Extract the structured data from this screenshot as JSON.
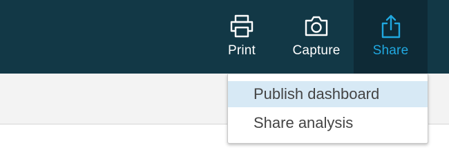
{
  "toolbar": {
    "print": {
      "label": "Print",
      "icon": "printer-icon"
    },
    "capture": {
      "label": "Capture",
      "icon": "camera-icon"
    },
    "share": {
      "label": "Share",
      "icon": "share-icon",
      "active": true
    }
  },
  "share_menu": {
    "items": [
      {
        "label": "Publish dashboard",
        "highlighted": true
      },
      {
        "label": "Share analysis",
        "highlighted": false
      }
    ]
  },
  "colors": {
    "topbar": "#123846",
    "active_tab_bg": "#0e2a36",
    "accent": "#20a8e0",
    "menu_highlight": "#d7e9f5"
  }
}
